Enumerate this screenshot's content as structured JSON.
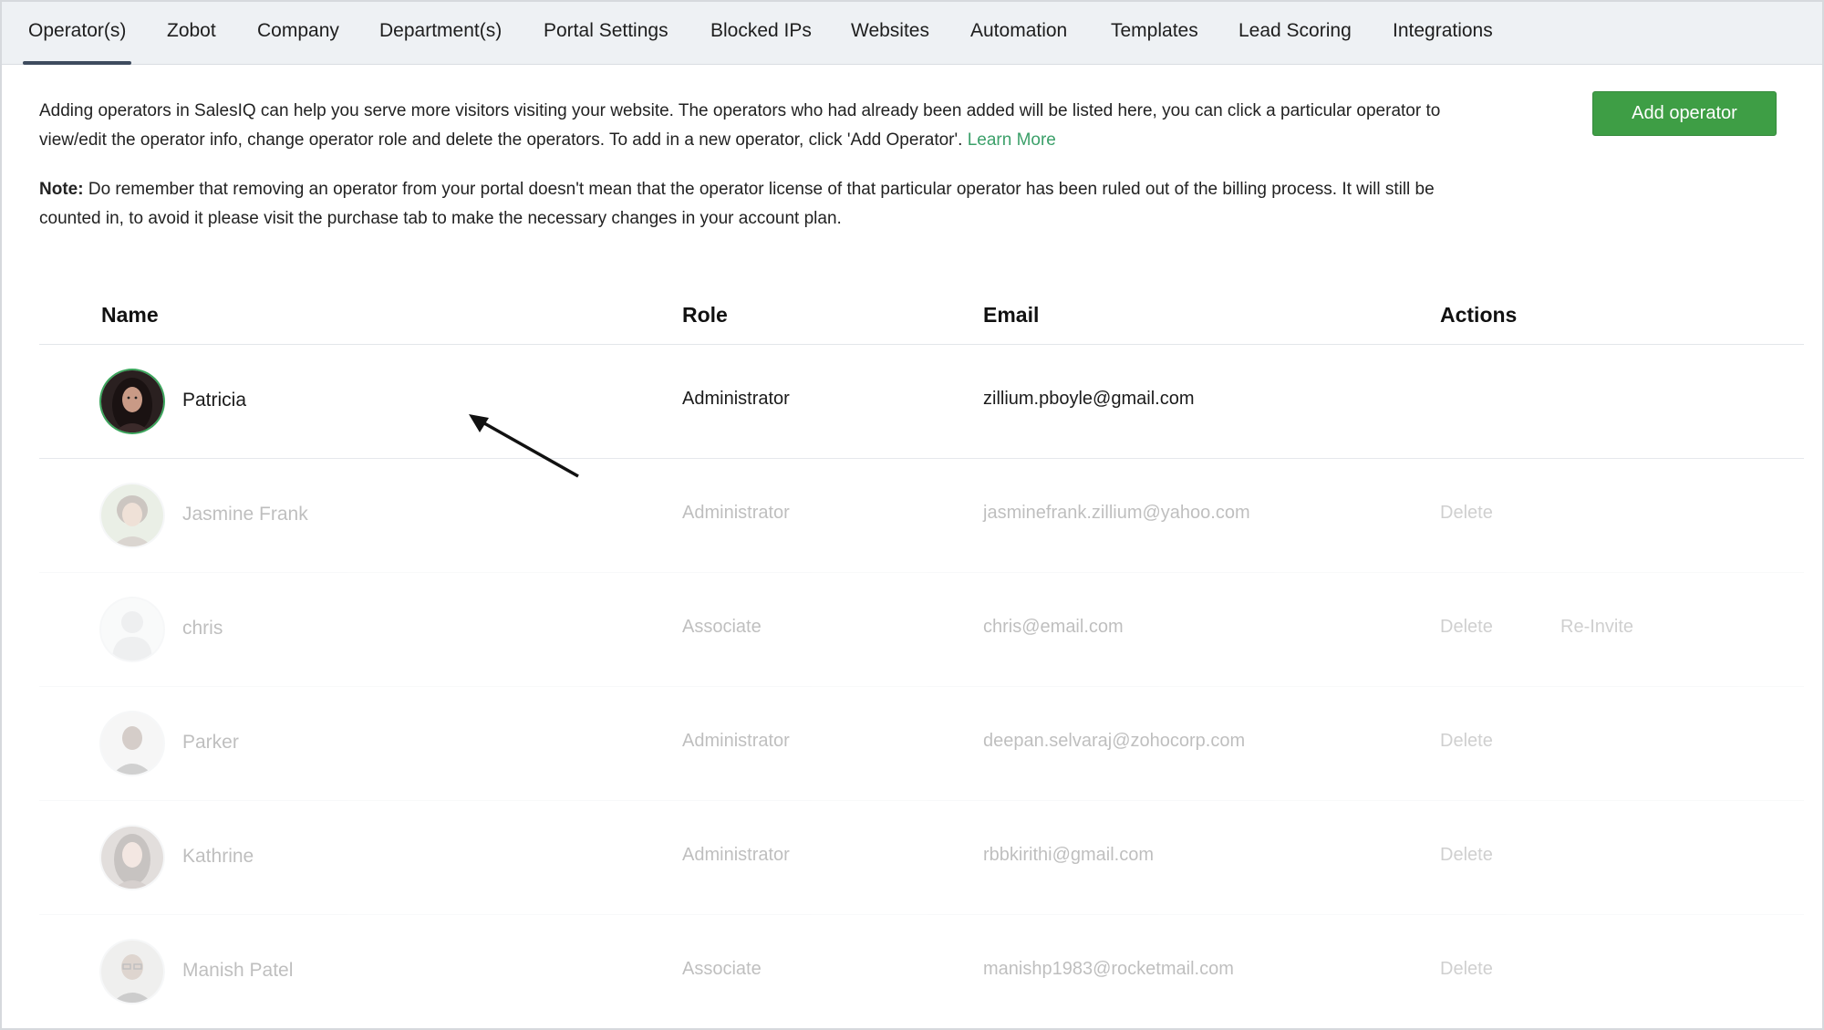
{
  "tabs": [
    {
      "label": "Operator(s)",
      "active": true
    },
    {
      "label": "Zobot"
    },
    {
      "label": "Company"
    },
    {
      "label": "Department(s)"
    },
    {
      "label": "Portal Settings"
    },
    {
      "label": "Blocked IPs"
    },
    {
      "label": "Websites"
    },
    {
      "label": "Automation"
    },
    {
      "label": "Templates"
    },
    {
      "label": "Lead Scoring"
    },
    {
      "label": "Integrations"
    }
  ],
  "intro": {
    "text": "Adding operators in SalesIQ can help you serve more visitors visiting your website. The operators who had already been added will be listed here, you can click a particular operator to view/edit the operator info, change operator role and delete the operators. To add in a new operator, click 'Add Operator'.",
    "link": "Learn More"
  },
  "note": {
    "label": "Note:",
    "text": "Do remember that removing an operator from your portal doesn't mean that the operator license of that particular operator has been ruled out of the billing process. It will still be counted in, to avoid it please visit the purchase tab to make the necessary changes in your account plan."
  },
  "add_button": "Add operator",
  "table": {
    "headers": {
      "name": "Name",
      "role": "Role",
      "email": "Email",
      "actions": "Actions"
    },
    "rows": [
      {
        "name": "Patricia",
        "role": "Administrator",
        "email": "zillium.pboyle@gmail.com",
        "action1": "",
        "action2": "",
        "avatar": "photo-woman-dark-hair-icon"
      },
      {
        "name": "Jasmine Frank",
        "role": "Administrator",
        "email": "jasminefrank.zillium@yahoo.com",
        "action1": "Delete",
        "action2": "",
        "avatar": "photo-woman-short-hair-icon"
      },
      {
        "name": "chris",
        "role": "Associate",
        "email": "chris@email.com",
        "action1": "Delete",
        "action2": "Re-Invite",
        "avatar": "default-user-icon"
      },
      {
        "name": "Parker",
        "role": "Administrator",
        "email": "deepan.selvaraj@zohocorp.com",
        "action1": "Delete",
        "action2": "",
        "avatar": "photo-man-icon"
      },
      {
        "name": "Kathrine",
        "role": "Administrator",
        "email": "rbbkirithi@gmail.com",
        "action1": "Delete",
        "action2": "",
        "avatar": "photo-woman-long-hair-icon"
      },
      {
        "name": "Manish Patel",
        "role": "Associate",
        "email": "manishp1983@rocketmail.com",
        "action1": "Delete",
        "action2": "",
        "avatar": "photo-man-glasses-icon"
      }
    ]
  },
  "colors": {
    "accent_green": "#3e9e45",
    "link_green": "#3ca06a",
    "tab_underline": "#3e4b5e",
    "tabbar_bg": "#eef1f4"
  }
}
